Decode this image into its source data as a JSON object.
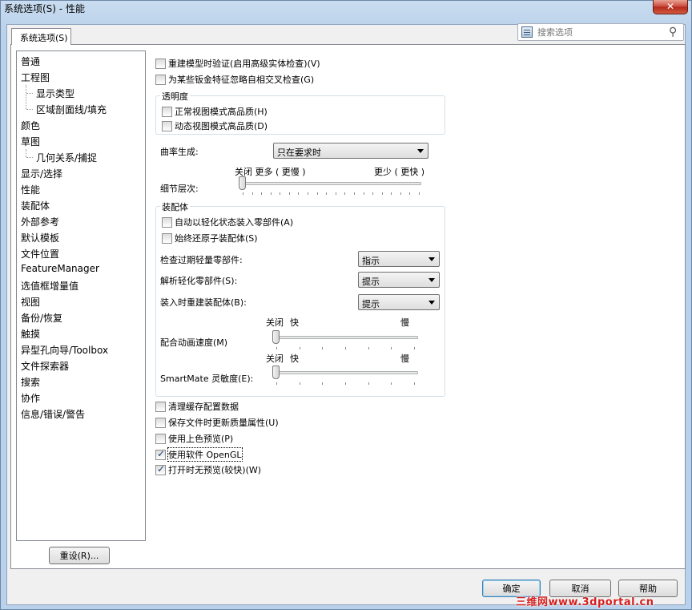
{
  "window": {
    "title": "系统选项(S) - 性能",
    "close_glyph": "✕"
  },
  "tab": {
    "label": "系统选项(S)"
  },
  "search": {
    "placeholder": "搜索选项"
  },
  "tree": {
    "items": [
      {
        "label": "普通",
        "level": 0
      },
      {
        "label": "工程图",
        "level": 0
      },
      {
        "label": "显示类型",
        "level": 1
      },
      {
        "label": "区域剖面线/填充",
        "level": 1
      },
      {
        "label": "颜色",
        "level": 0
      },
      {
        "label": "草图",
        "level": 0
      },
      {
        "label": "几何关系/捕捉",
        "level": 1
      },
      {
        "label": "显示/选择",
        "level": 0
      },
      {
        "label": "性能",
        "level": 0
      },
      {
        "label": "装配体",
        "level": 0
      },
      {
        "label": "外部参考",
        "level": 0
      },
      {
        "label": "默认模板",
        "level": 0
      },
      {
        "label": "文件位置",
        "level": 0
      },
      {
        "label": "FeatureManager",
        "level": 0
      },
      {
        "label": "选值框增量值",
        "level": 0
      },
      {
        "label": "视图",
        "level": 0
      },
      {
        "label": "备份/恢复",
        "level": 0
      },
      {
        "label": "触摸",
        "level": 0
      },
      {
        "label": "异型孔向导/Toolbox",
        "level": 0
      },
      {
        "label": "文件探索器",
        "level": 0
      },
      {
        "label": "搜索",
        "level": 0
      },
      {
        "label": "协作",
        "level": 0
      },
      {
        "label": "信息/错误/警告",
        "level": 0
      }
    ]
  },
  "reset_button": "重设(R)...",
  "top_checks": [
    {
      "label": "重建模型时验证(启用高级实体检查)(V)",
      "checked": false
    },
    {
      "label": "为某些钣金特征忽略自相交叉检查(G)",
      "checked": false
    }
  ],
  "transparency": {
    "title": "透明度",
    "checks": [
      {
        "label": "正常视图模式高品质(H)",
        "checked": false
      },
      {
        "label": "动态视图模式高品质(D)",
        "checked": false
      }
    ]
  },
  "curvature": {
    "label": "曲率生成:",
    "value": "只在要求时"
  },
  "detail": {
    "label": "细节层次:",
    "left_caption": "关闭 更多 ( 更慢 )",
    "right_caption": "更少 ( 更快 )",
    "level": 0
  },
  "assembly": {
    "title": "装配体",
    "checks": [
      {
        "label": "自动以轻化状态装入零部件(A)",
        "checked": false
      },
      {
        "label": "始终还原子装配体(S)",
        "checked": false
      }
    ],
    "combos": [
      {
        "label": "检查过期轻量零部件:",
        "value": "指示"
      },
      {
        "label": "解析轻化零部件(S):",
        "value": "提示"
      },
      {
        "label": "装入时重建装配体(B):",
        "value": "提示"
      }
    ],
    "anim_speed": {
      "label": "配合动画速度(M)",
      "cap_off": "关闭",
      "cap_fast": "快",
      "cap_slow": "慢",
      "level": 0
    },
    "smartmate": {
      "label": "SmartMate 灵敏度(E):",
      "cap_off": "关闭",
      "cap_fast": "快",
      "cap_slow": "慢",
      "level": 0
    }
  },
  "bottom_checks": [
    {
      "label": "清理缓存配置数据",
      "checked": false
    },
    {
      "label": "保存文件时更新质量属性(U)",
      "checked": false
    },
    {
      "label": "使用上色预览(P)",
      "checked": false
    },
    {
      "label": "使用软件 OpenGL",
      "checked": true
    },
    {
      "label": "打开时无预览(较快)(W)",
      "checked": true
    }
  ],
  "footer": {
    "ok": "确定",
    "cancel": "取消",
    "help": "帮助"
  },
  "watermark": "三维网www.3dportal.cn"
}
